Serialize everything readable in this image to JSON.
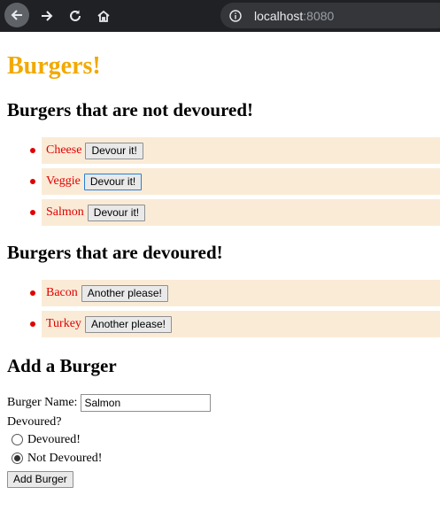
{
  "browser": {
    "url_host": "localhost",
    "url_port": ":8080"
  },
  "page": {
    "title": "Burgers!",
    "not_devoured_heading": "Burgers that are not devoured!",
    "devoured_heading": "Burgers that are devoured!",
    "add_heading": "Add a Burger"
  },
  "not_devoured": [
    {
      "name": "Cheese",
      "button": "Devour it!"
    },
    {
      "name": "Veggie",
      "button": "Devour it!"
    },
    {
      "name": "Salmon",
      "button": "Devour it!"
    }
  ],
  "devoured": [
    {
      "name": "Bacon",
      "button": "Another please!"
    },
    {
      "name": "Turkey",
      "button": "Another please!"
    }
  ],
  "form": {
    "name_label": "Burger Name:",
    "name_value": "Salmon",
    "devoured_label": "Devoured?",
    "options": [
      {
        "label": "Devoured!",
        "checked": false
      },
      {
        "label": "Not Devoured!",
        "checked": true
      }
    ],
    "submit_label": "Add Burger"
  },
  "colors": {
    "title": "#f2a900",
    "item_bg": "#faebd7",
    "item_text": "#e00000"
  }
}
